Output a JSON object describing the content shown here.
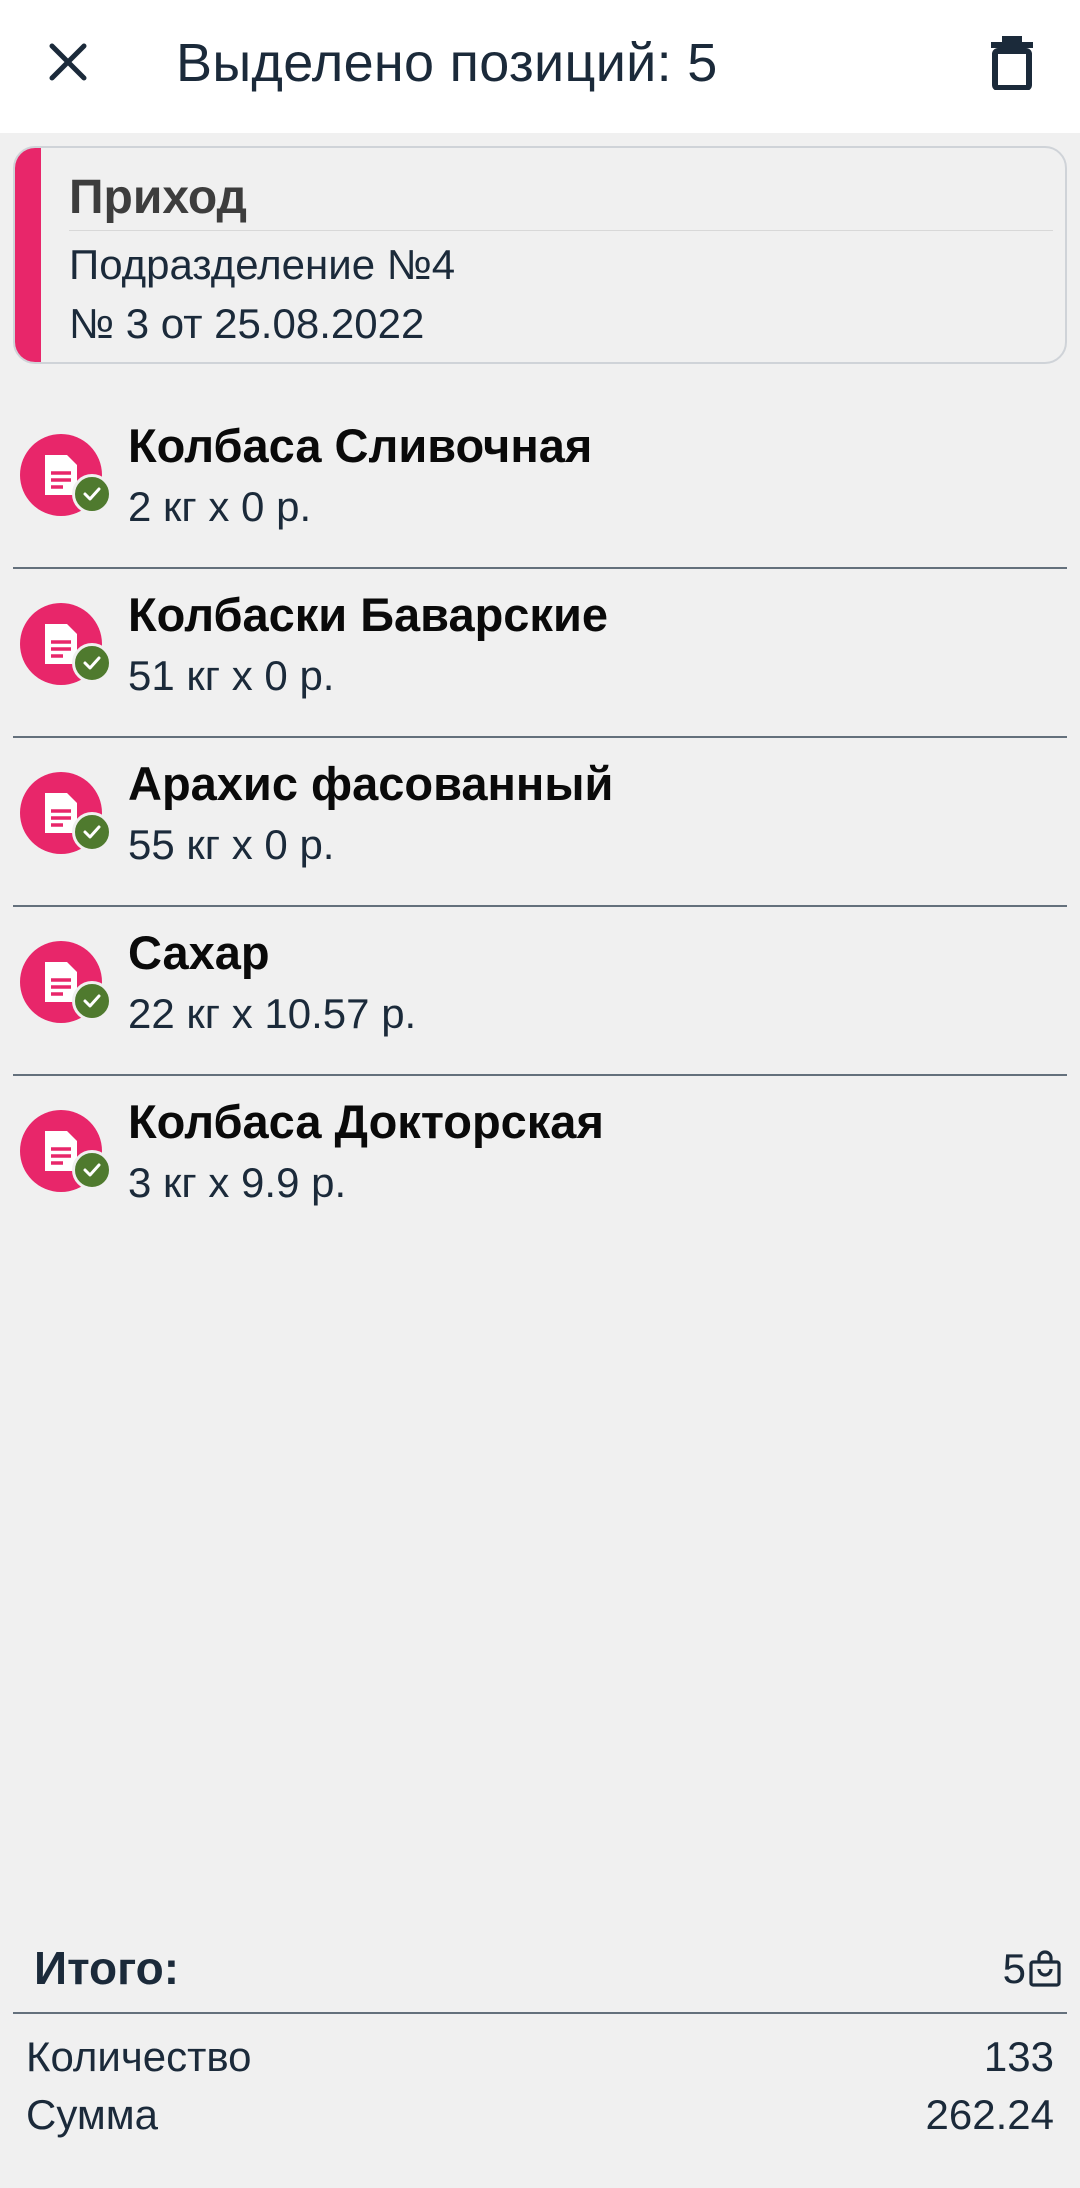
{
  "header": {
    "title": "Выделено позиций: 5",
    "close_icon": "close-icon",
    "delete_icon": "trash-icon"
  },
  "document": {
    "type": "Приход",
    "department": "Подразделение №4",
    "number_date": "№ 3 от 25.08.2022",
    "accent_color": "#e8266a"
  },
  "items": [
    {
      "name": "Колбаса Сливочная",
      "qty": "2 кг x 0 р.",
      "icon": "document-icon",
      "status": "check-icon"
    },
    {
      "name": "Колбаски Баварские",
      "qty": "51 кг x 0 р.",
      "icon": "document-icon",
      "status": "check-icon"
    },
    {
      "name": "Арахис фасованный",
      "qty": "55 кг x 0 р.",
      "icon": "document-icon",
      "status": "check-icon"
    },
    {
      "name": "Сахар",
      "qty": "22 кг x 10.57 р.",
      "icon": "document-icon",
      "status": "check-icon"
    },
    {
      "name": "Колбаса Докторская",
      "qty": "3 кг x 9.9 р.",
      "icon": "document-icon",
      "status": "check-icon"
    }
  ],
  "totals": {
    "label": "Итого:",
    "positions_count": "5",
    "quantity_label": "Количество",
    "quantity_value": "133",
    "sum_label": "Сумма",
    "sum_value": "262.24"
  },
  "colors": {
    "accent": "#e8266a",
    "check": "#4f7a2e",
    "text": "#1b2a3a",
    "background": "#f0f0f0"
  }
}
